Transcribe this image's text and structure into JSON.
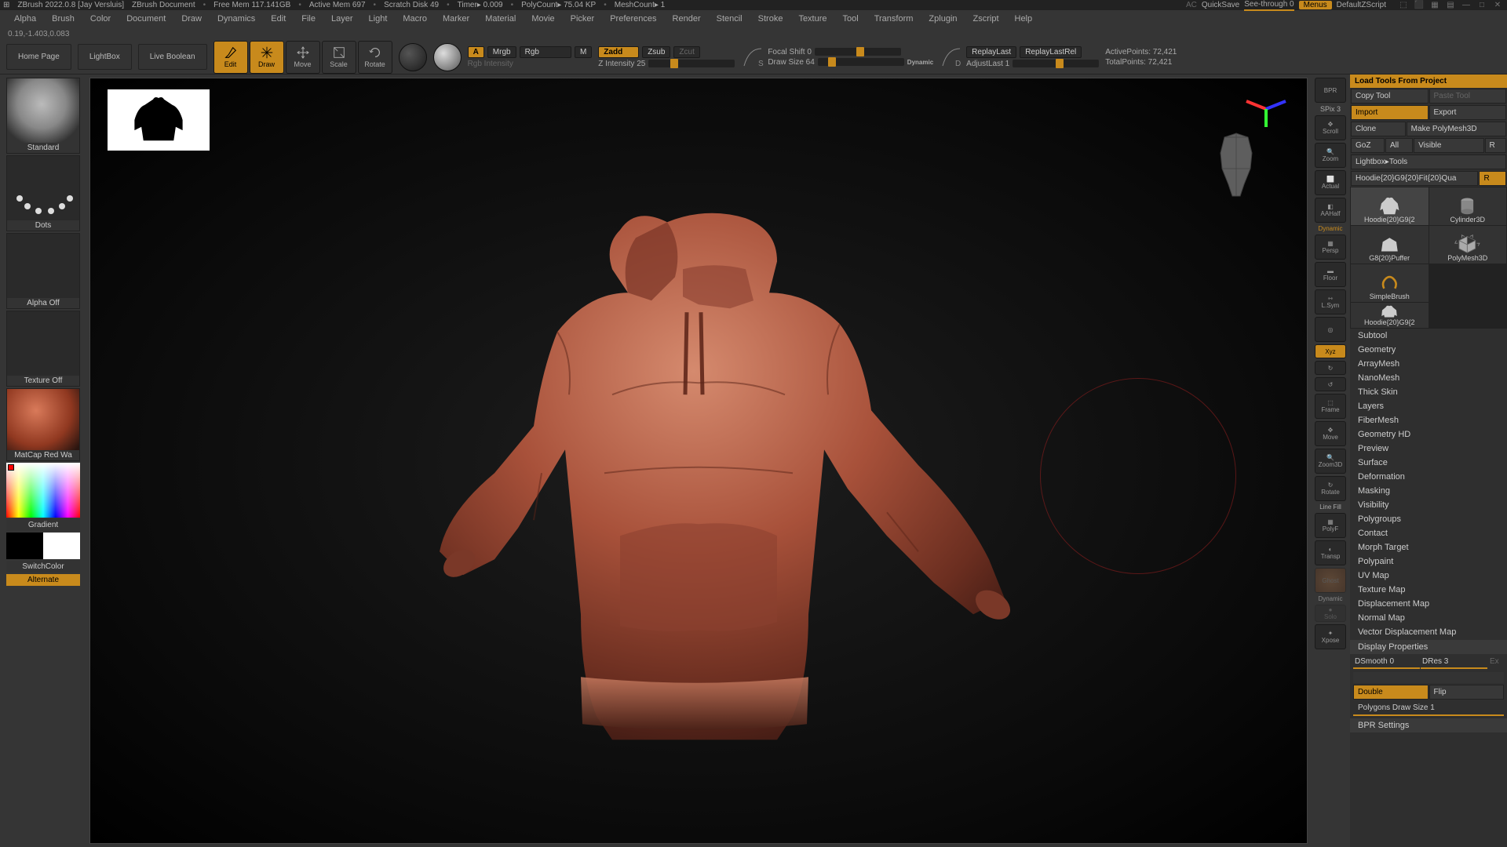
{
  "titlebar": {
    "app": "ZBrush 2022.0.8 [Jay Versluis]",
    "doc": "ZBrush Document",
    "freemem": "Free Mem 117.141GB",
    "activemem": "Active Mem 697",
    "scratch": "Scratch Disk 49",
    "timer": "Timer▸ 0.009",
    "polycount": "PolyCount▸ 75.04 KP",
    "meshcount": "MeshCount▸ 1",
    "ac": "AC",
    "quicksave": "QuickSave",
    "seethrough": "See-through  0",
    "menus": "Menus",
    "defaultscript": "DefaultZScript"
  },
  "menus": [
    "Alpha",
    "Brush",
    "Color",
    "Document",
    "Draw",
    "Dynamics",
    "Edit",
    "File",
    "Layer",
    "Light",
    "Macro",
    "Marker",
    "Material",
    "Movie",
    "Picker",
    "Preferences",
    "Render",
    "Stencil",
    "Stroke",
    "Texture",
    "Tool",
    "Transform",
    "Zplugin",
    "Zscript",
    "Help"
  ],
  "status": "0.19,-1.403,0.083",
  "toolbar": {
    "home": "Home Page",
    "lightbox": "LightBox",
    "liveboolean": "Live Boolean",
    "modes": [
      "Edit",
      "Draw",
      "Move",
      "Scale",
      "Rotate"
    ],
    "a": "A",
    "mrgb": "Mrgb",
    "rgb": "Rgb",
    "m": "M",
    "rgbintensity": "Rgb Intensity",
    "zadd": "Zadd",
    "zsub": "Zsub",
    "zcut": "Zcut",
    "zintensity": "Z Intensity 25",
    "focalshift": "Focal Shift 0",
    "drawsize": "Draw Size 64",
    "dynamic": "Dynamic",
    "replaylast": "ReplayLast",
    "replaylastrel": "ReplayLastRel",
    "adjustlast": "AdjustLast 1",
    "activepoints": "ActivePoints: 72,421",
    "totalpoints": "TotalPoints: 72,421"
  },
  "left": {
    "brush": "Standard",
    "stroke": "Dots",
    "alpha": "Alpha Off",
    "texture": "Texture Off",
    "material": "MatCap Red Wa",
    "gradient": "Gradient",
    "switchcolor": "SwitchColor",
    "alternate": "Alternate"
  },
  "rightstrip": {
    "bpr": "BPR",
    "spix": "SPix 3",
    "scroll": "Scroll",
    "zoom": "Zoom",
    "actual": "Actual",
    "aahalf": "AAHalf",
    "persp": "Persp",
    "floor": "Floor",
    "lsym": "L.Sym",
    "xyz": "Xyz",
    "frame": "Frame",
    "move": "Move",
    "zoom3d": "Zoom3D",
    "rotate": "Rotate",
    "polyf": "PolyF",
    "transp": "Transp",
    "ghost": "Ghost",
    "solo": "Solo",
    "xpose": "Xpose",
    "linefill": "Line Fill",
    "dynamic": "Dynamic"
  },
  "rightpanel": {
    "loadtools": "Load Tools From Project",
    "copytool": "Copy Tool",
    "pastetool": "Paste Tool",
    "import": "Import",
    "export": "Export",
    "clone": "Clone",
    "makepm": "Make PolyMesh3D",
    "goz": "GoZ",
    "all": "All",
    "visible": "Visible",
    "r": "R",
    "lightboxtools": "Lightbox▸Tools",
    "currenttool": "Hoodie{20}G9{20}Fit{20}Qua",
    "tools": [
      {
        "name": "Hoodie{20}G9{2"
      },
      {
        "name": "Cylinder3D"
      },
      {
        "name": "G8{20}Puffer"
      },
      {
        "name": "SimpleBrush"
      },
      {
        "name": "Hoodie{20}G9{2"
      },
      {
        "name": "PolyMesh3D"
      }
    ],
    "palettes": [
      "Subtool",
      "Geometry",
      "ArrayMesh",
      "NanoMesh",
      "Thick Skin",
      "Layers",
      "FiberMesh",
      "Geometry HD",
      "Preview",
      "Surface",
      "Deformation",
      "Masking",
      "Visibility",
      "Polygroups",
      "Contact",
      "Morph Target",
      "Polypaint",
      "UV Map",
      "Texture Map",
      "Displacement Map",
      "Normal Map",
      "Vector Displacement Map"
    ],
    "displayprops": "Display Properties",
    "dsmooth": "DSmooth 0",
    "dres": "DRes 3",
    "ex": "Ex",
    "double": "Double",
    "flip": "Flip",
    "polydrawsize": "Polygons Draw Size 1",
    "bprsettings": "BPR Settings"
  }
}
